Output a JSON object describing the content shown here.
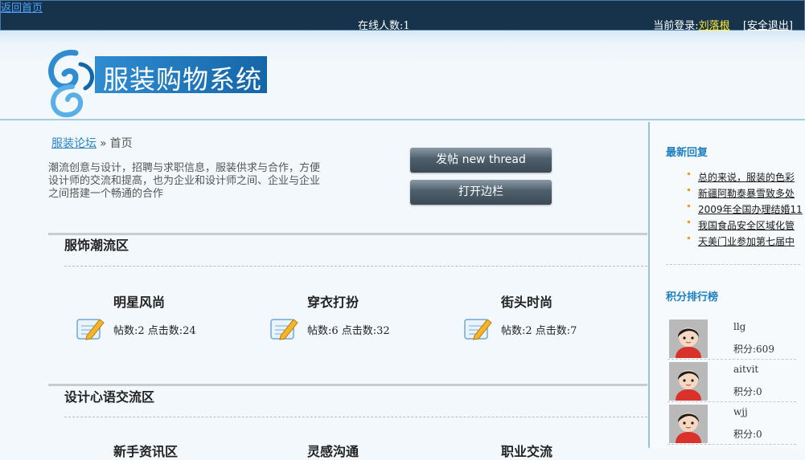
{
  "topbar": {
    "back_link": "返回首页",
    "online": "在线人数:1",
    "login_prefix": "当前登录:",
    "username": "刘落根",
    "logout": "安全退出",
    "bracket_open": "[",
    "bracket_close": "]"
  },
  "header": {
    "logo_text": "服装购物系统"
  },
  "breadcrumb": {
    "link": "服装论坛",
    "sep": "»",
    "current": "首页"
  },
  "intro": "潮流创意与设计，招聘与求职信息，服装供求与合作，方便设计师的交流和提高，也为企业和设计师之间、企业与企业之间搭建一个畅通的合作",
  "buttons": {
    "post": "发帖  new thread",
    "sidebar": "打开边栏"
  },
  "sections": [
    {
      "title": "服饰潮流区",
      "boards": [
        {
          "name": "明星风尚",
          "stats": "帖数:2 点击数:24"
        },
        {
          "name": "穿衣打扮",
          "stats": "帖数:6 点击数:32"
        },
        {
          "name": "街头时尚",
          "stats": "帖数:2 点击数:7"
        }
      ]
    },
    {
      "title": "设计心语交流区",
      "boards": [
        {
          "name": "新手资讯区",
          "stats": ""
        },
        {
          "name": "灵感沟通",
          "stats": ""
        },
        {
          "name": "职业交流",
          "stats": ""
        }
      ]
    }
  ],
  "sidebar": {
    "latest_title": "最新回复",
    "latest": [
      "总的来说，服装的色彩",
      "新疆阿勒泰暴雪致多处",
      "2009年全国办理结婚11",
      "我国食品安全区域化管",
      "天美门业参加第七届中"
    ],
    "rank_title": "积分排行榜",
    "ranks": [
      {
        "name": "llg",
        "score": "积分:609"
      },
      {
        "name": "aitvit",
        "score": "积分:0"
      },
      {
        "name": "wjj",
        "score": "积分:0"
      }
    ]
  },
  "colors": {
    "topbar": "#17334b",
    "accent": "#1d7fc0",
    "username": "#ffea3a",
    "bullet": "#f29a18"
  },
  "icons": {
    "board": "edit-note-icon",
    "logo": "swirl-logo-icon",
    "avatar": "cartoon-avatar-icon"
  }
}
